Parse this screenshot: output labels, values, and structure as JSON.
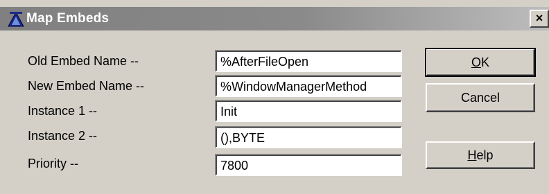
{
  "window": {
    "title": "Map Embeds",
    "close_glyph": "×"
  },
  "fields": [
    {
      "label": "Old Embed Name --",
      "value": "%AfterFileOpen"
    },
    {
      "label": "New Embed Name --",
      "value": "%WindowManagerMethod"
    },
    {
      "label": "Instance 1 --",
      "value": "Init"
    },
    {
      "label": "Instance 2 --",
      "value": "(),BYTE"
    },
    {
      "label": "Priority --",
      "value": "7800"
    }
  ],
  "buttons": {
    "ok": {
      "accel": "O",
      "rest": "K"
    },
    "cancel": {
      "label": "Cancel"
    },
    "help": {
      "accel": "H",
      "rest": "elp"
    }
  },
  "icons": {
    "title": "template-icon",
    "close": "close-icon"
  }
}
